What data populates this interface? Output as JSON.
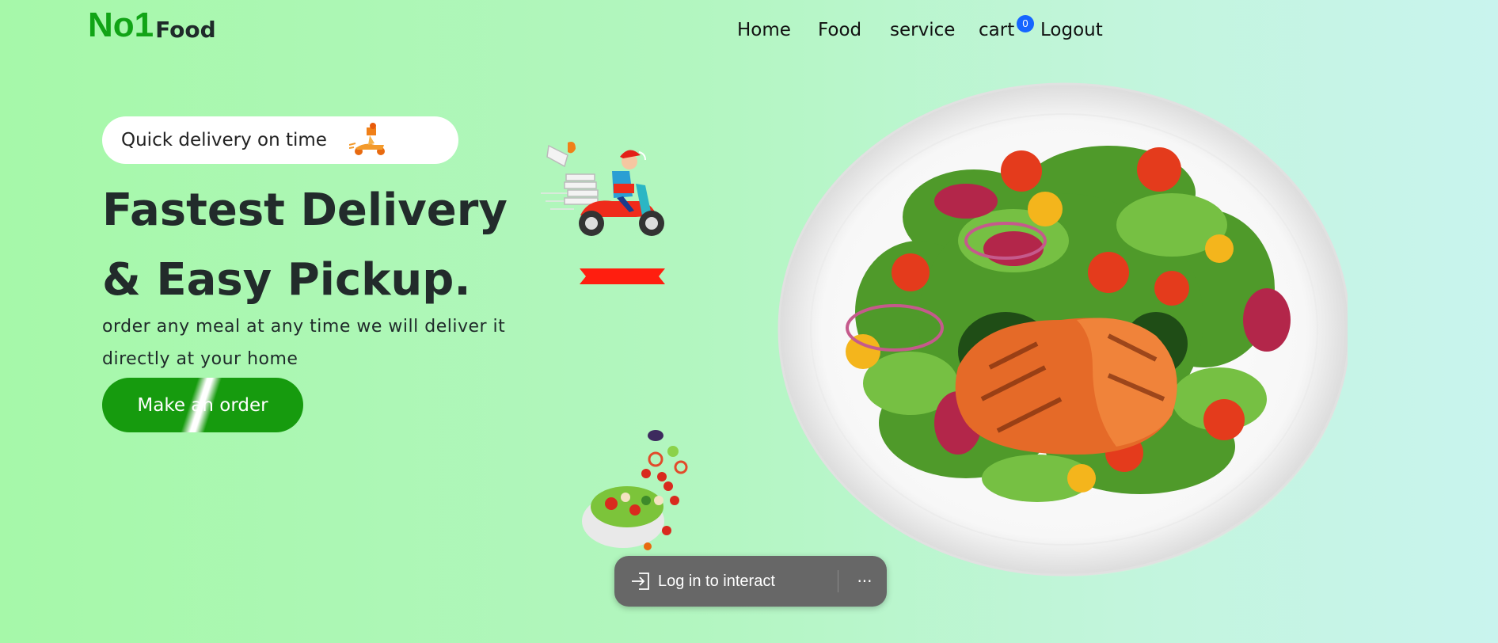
{
  "brand": {
    "no1": "No1",
    "food": "Food"
  },
  "nav": {
    "items": [
      {
        "label": "Home"
      },
      {
        "label": "Food"
      },
      {
        "label": "service"
      },
      {
        "label": "cart"
      },
      {
        "label": "Logout"
      }
    ],
    "cart_count": "0"
  },
  "hero": {
    "pill_text": "Quick delivery on time",
    "headline": "Fastest Delivery & Easy Pickup.",
    "subtext": "order any meal at any time we will deliver it directly at your home",
    "cta_label": "Make an order"
  },
  "overlay": {
    "login_text": "Log in to interact",
    "more_label": "···"
  },
  "icons": {
    "pill": "delivery-scooter-icon",
    "login": "sign-in-icon",
    "more": "more-options-icon"
  },
  "colors": {
    "brand_green": "#11a416",
    "cta_green": "#169b0e",
    "badge_blue": "#1565ff",
    "ribbon_red": "#ff1e0f",
    "overlay_gray": "#676767"
  }
}
